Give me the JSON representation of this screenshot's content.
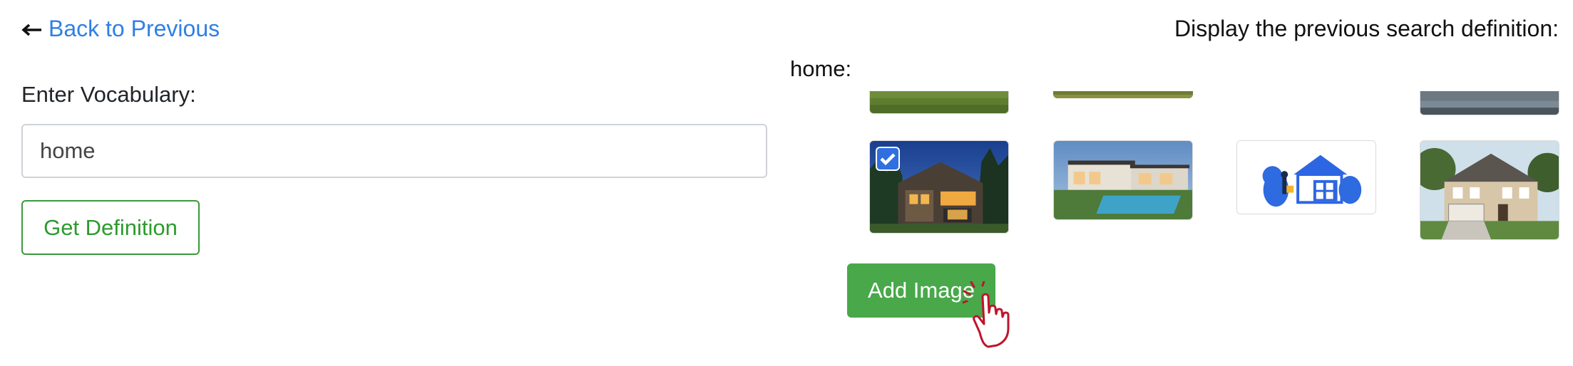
{
  "nav": {
    "back_label": "Back to Previous",
    "back_icon": "arrow-left-icon"
  },
  "header": {
    "previous_definition_label": "Display the previous search definition:"
  },
  "vocab": {
    "label": "Enter Vocabulary:",
    "value": "home",
    "get_definition_label": "Get Definition"
  },
  "results": {
    "word": "home:",
    "images": [
      {
        "name": "grass-lawn-image",
        "selected": false,
        "row": "partial"
      },
      {
        "name": "garden-image",
        "selected": false,
        "row": "partial"
      },
      {
        "name": "lake-view-image",
        "selected": false,
        "row": "partial"
      },
      {
        "name": "modern-house-night-image",
        "selected": true,
        "row": "full"
      },
      {
        "name": "house-with-pool-image",
        "selected": false,
        "row": "full"
      },
      {
        "name": "house-illustration-image",
        "selected": false,
        "row": "full"
      },
      {
        "name": "suburban-house-image",
        "selected": false,
        "row": "full"
      }
    ],
    "add_image_label": "Add Image"
  },
  "colors": {
    "link": "#2f7fe5",
    "success": "#49a84a",
    "checkbox": "#2f6fe0",
    "cursor": "#c0132a"
  }
}
